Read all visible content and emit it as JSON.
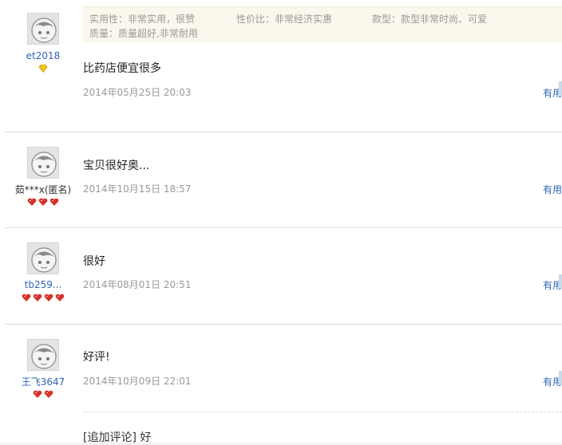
{
  "review1": {
    "username": "et2018",
    "tags": {
      "practicality": "实用性：非常实用，很赞",
      "value": "性价比：非常经济实惠",
      "style": "款型：款型非常时尚、可爱",
      "quality": "质量：质量超好,非常耐用"
    },
    "text": "比药店便宜很多",
    "date": "2014年05月25日 20:03",
    "useful": "有用"
  },
  "review2": {
    "username": "茹***x(匿名)",
    "text": "宝贝很好奥...",
    "date": "2014年10月15日 18:57",
    "useful": "有用"
  },
  "review3": {
    "username": "tb259...",
    "text": "很好",
    "date": "2014年08月01日 20:51",
    "useful": "有用"
  },
  "review4": {
    "username": "王飞3647",
    "text": "好评!",
    "date": "2014年10月09日 22:01",
    "useful": "有用",
    "append_text": "[追加评论] 好"
  },
  "colors": {
    "link": "#2f64b4",
    "date": "#999999",
    "tag_bg": "#fbf7ec",
    "heart": "#d9312b",
    "diamond": "#f0c419"
  },
  "icons": [
    "default-avatar-icon",
    "yellow-diamond-icon",
    "red-heart-icon"
  ]
}
